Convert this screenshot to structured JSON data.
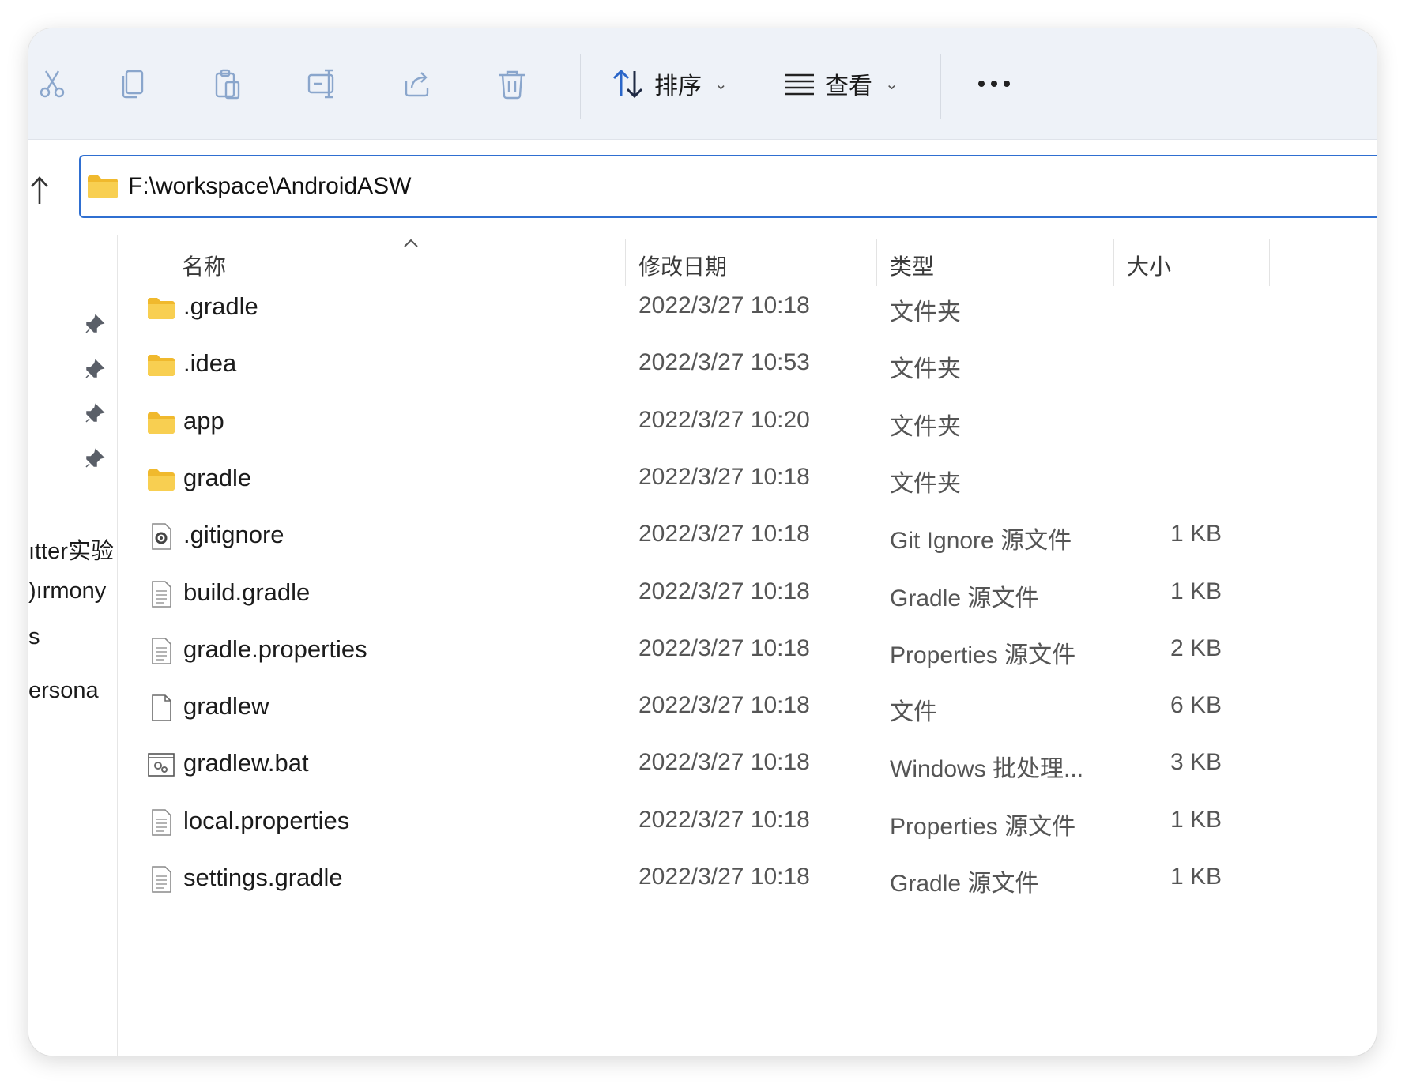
{
  "toolbar": {
    "icons": [
      "cut-icon",
      "copy-icon",
      "paste-icon",
      "rename-icon",
      "share-icon",
      "delete-icon"
    ],
    "sort_label": "排序",
    "view_label": "查看"
  },
  "address": {
    "path": "F:\\workspace\\AndroidASW"
  },
  "nav": {
    "items": [
      "ıtter实验",
      "ırmony(",
      "s",
      "ersona"
    ]
  },
  "columns": {
    "name": "名称",
    "date": "修改日期",
    "type": "类型",
    "size": "大小"
  },
  "files": [
    {
      "name": ".gradle",
      "date": "2022/3/27 10:18",
      "type": "文件夹",
      "size": "",
      "icon": "folder-icon"
    },
    {
      "name": ".idea",
      "date": "2022/3/27 10:53",
      "type": "文件夹",
      "size": "",
      "icon": "folder-icon"
    },
    {
      "name": "app",
      "date": "2022/3/27 10:20",
      "type": "文件夹",
      "size": "",
      "icon": "folder-icon"
    },
    {
      "name": "gradle",
      "date": "2022/3/27 10:18",
      "type": "文件夹",
      "size": "",
      "icon": "folder-icon"
    },
    {
      "name": ".gitignore",
      "date": "2022/3/27 10:18",
      "type": "Git Ignore 源文件",
      "size": "1 KB",
      "icon": "config-file-icon"
    },
    {
      "name": "build.gradle",
      "date": "2022/3/27 10:18",
      "type": "Gradle 源文件",
      "size": "1 KB",
      "icon": "text-file-icon"
    },
    {
      "name": "gradle.properties",
      "date": "2022/3/27 10:18",
      "type": "Properties 源文件",
      "size": "2 KB",
      "icon": "text-file-icon"
    },
    {
      "name": "gradlew",
      "date": "2022/3/27 10:18",
      "type": "文件",
      "size": "6 KB",
      "icon": "blank-file-icon"
    },
    {
      "name": "gradlew.bat",
      "date": "2022/3/27 10:18",
      "type": "Windows 批处理...",
      "size": "3 KB",
      "icon": "batch-file-icon"
    },
    {
      "name": "local.properties",
      "date": "2022/3/27 10:18",
      "type": "Properties 源文件",
      "size": "1 KB",
      "icon": "text-file-icon"
    },
    {
      "name": "settings.gradle",
      "date": "2022/3/27 10:18",
      "type": "Gradle 源文件",
      "size": "1 KB",
      "icon": "text-file-icon"
    }
  ],
  "colors": {
    "accent": "#2f6fd1",
    "folder": "#f6c744",
    "toolbar_bg": "#eef2f8"
  }
}
